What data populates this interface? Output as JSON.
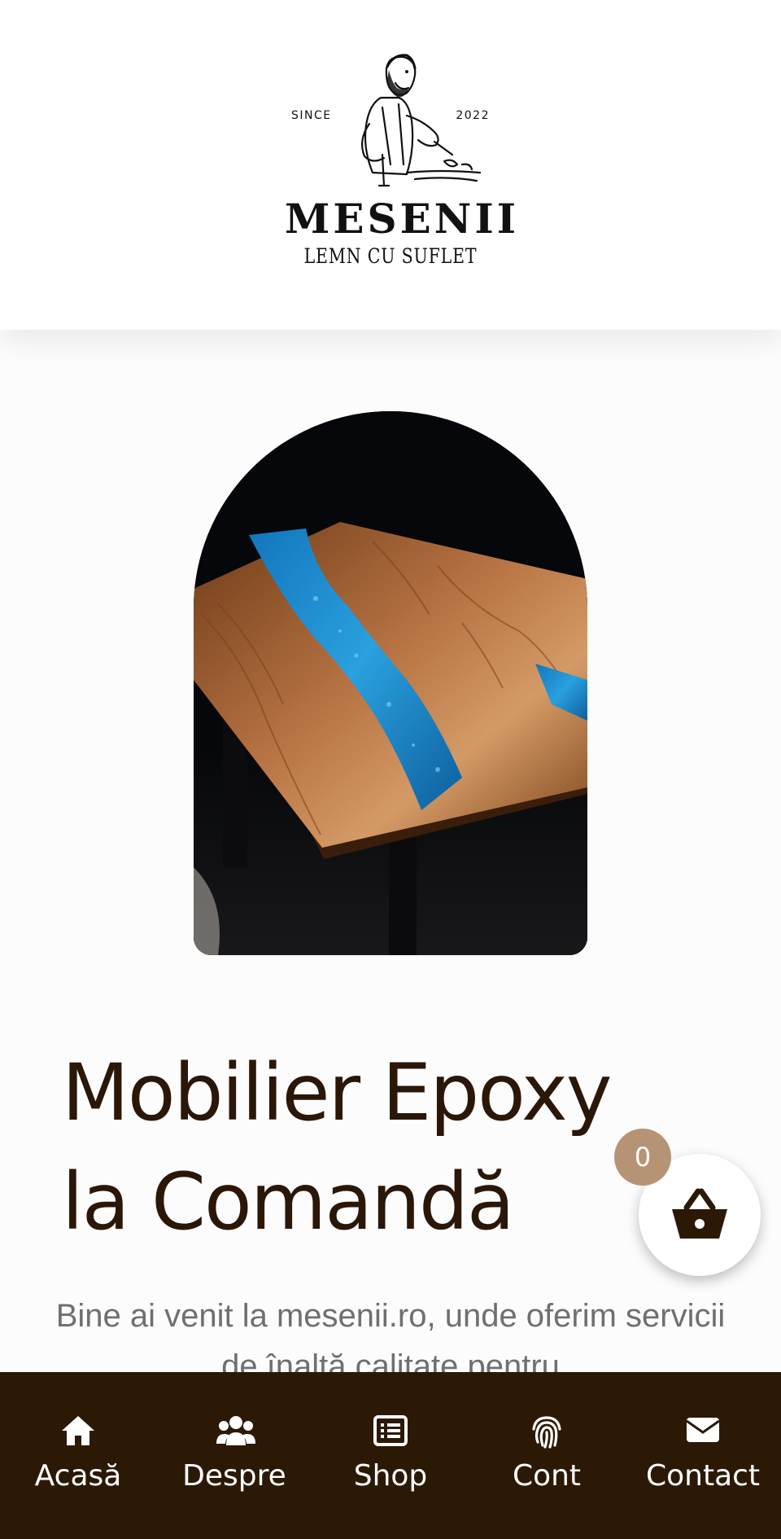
{
  "brand": {
    "since": "SINCE",
    "year": "2022",
    "name": "MESENII",
    "tagline": "LEMN CU SUFLET"
  },
  "hero": {
    "title": "Mobilier Epoxy la Comandă",
    "intro": "Bine ai venit la mesenii.ro, unde oferim servicii de înaltă calitate pentru"
  },
  "cart": {
    "count": "0",
    "icon": "basket-icon"
  },
  "bottom_nav": {
    "items": [
      {
        "label": "Acasă",
        "icon": "home-icon"
      },
      {
        "label": "Despre",
        "icon": "users-icon"
      },
      {
        "label": "Shop",
        "icon": "list-icon"
      },
      {
        "label": "Cont",
        "icon": "fingerprint-icon"
      },
      {
        "label": "Contact",
        "icon": "envelope-icon"
      }
    ]
  },
  "colors": {
    "nav_background": "#2b1906",
    "title_color": "#2a1708",
    "badge_color": "#b79376",
    "resin_blue": "#1f8fd0"
  }
}
